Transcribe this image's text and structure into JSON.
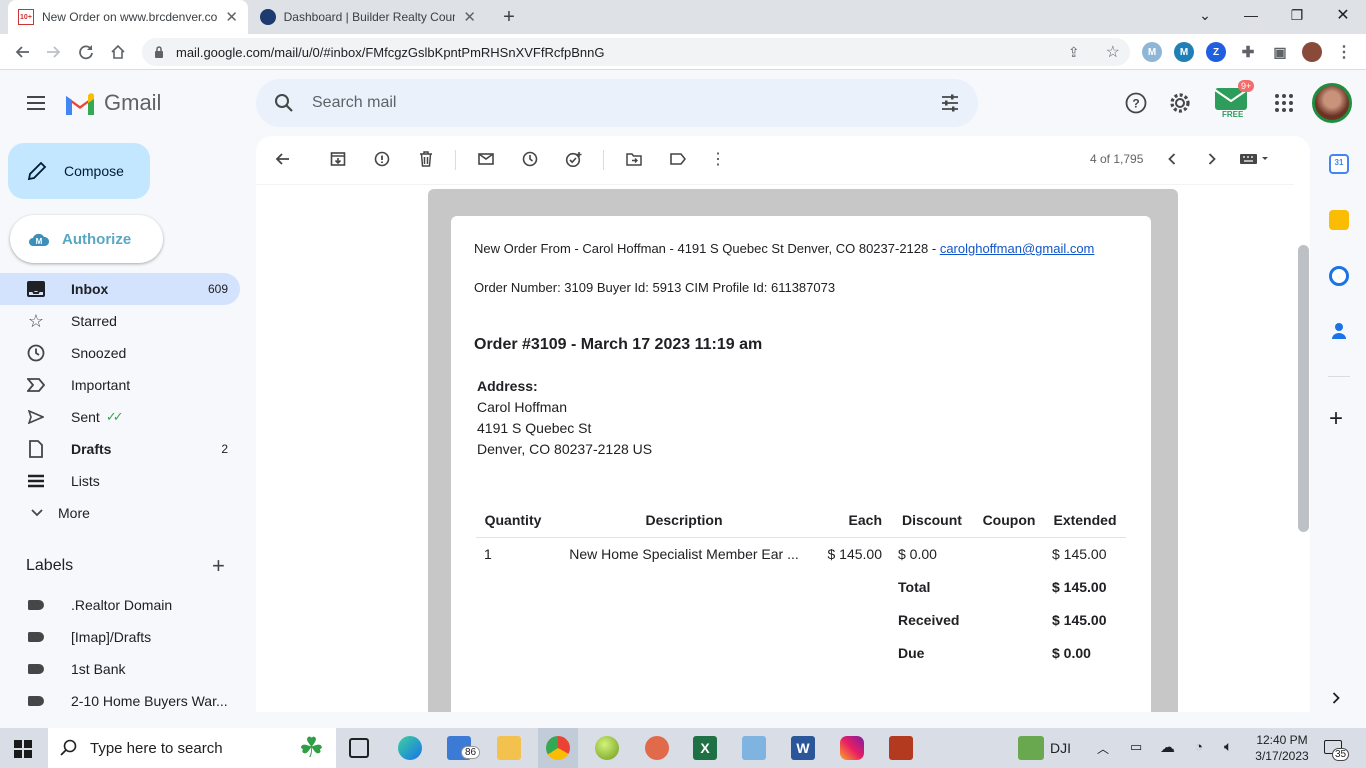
{
  "browser": {
    "tabs": [
      {
        "title": "New Order on www.brcdenver.com",
        "favicon_text": "10+"
      },
      {
        "title": "Dashboard | Builder Realty Council"
      }
    ],
    "url": "mail.google.com/mail/u/0/#inbox/FMfcgzGslbKpntPmRHSnXVFfRcfpBnnG"
  },
  "gmail": {
    "logo_text": "Gmail",
    "search_placeholder": "Search mail",
    "compose_label": "Compose",
    "authorize_label": "Authorize",
    "checker_badge": "9+",
    "checker_label": "FREE",
    "nav": [
      {
        "label": "Inbox",
        "count": "609"
      },
      {
        "label": "Starred",
        "count": ""
      },
      {
        "label": "Snoozed",
        "count": ""
      },
      {
        "label": "Important",
        "count": ""
      },
      {
        "label": "Sent",
        "count": ""
      },
      {
        "label": "Drafts",
        "count": "2"
      },
      {
        "label": "Lists",
        "count": ""
      },
      {
        "label": "More",
        "count": ""
      }
    ],
    "labels_heading": "Labels",
    "labels": [
      ".Realtor Domain",
      "[Imap]/Drafts",
      "1st Bank",
      "2-10 Home Buyers War..."
    ],
    "pagination": "4 of 1,795"
  },
  "email": {
    "line1_text": "New Order From - Carol Hoffman - 4191 S Quebec St Denver, CO 80237-2128 - ",
    "line1_link": "carolghoffman@gmail.com",
    "line2": "Order Number: 3109 Buyer Id: 5913 CIM Profile Id: 611387073",
    "order_title": "Order #3109 - March 17 2023 11:19 am",
    "address_label": "Address:",
    "address_lines": [
      "Carol Hoffman",
      "4191 S Quebec St",
      "Denver, CO 80237-2128 US"
    ],
    "table": {
      "headers": [
        "Quantity",
        "Description",
        "Each",
        "Discount",
        "Coupon",
        "Extended"
      ],
      "row": [
        "1",
        "New Home Specialist Member Ear ...",
        "$ 145.00",
        "$ 0.00",
        "",
        "$ 145.00"
      ],
      "totals": [
        {
          "label": "Total",
          "value": "$ 145.00"
        },
        {
          "label": "Received",
          "value": "$ 145.00"
        },
        {
          "label": "Due",
          "value": "$ 0.00"
        }
      ]
    }
  },
  "taskbar": {
    "search_placeholder": "Type here to search",
    "mail_badge": "86",
    "dji_label": "DJI",
    "time": "12:40 PM",
    "date": "3/17/2023",
    "notif_count": "35"
  },
  "colors": {
    "gmail_red": "#ea4335",
    "compose_bg": "#c2e7ff",
    "selected_nav": "#d3e3fd",
    "link": "#1155cc"
  }
}
